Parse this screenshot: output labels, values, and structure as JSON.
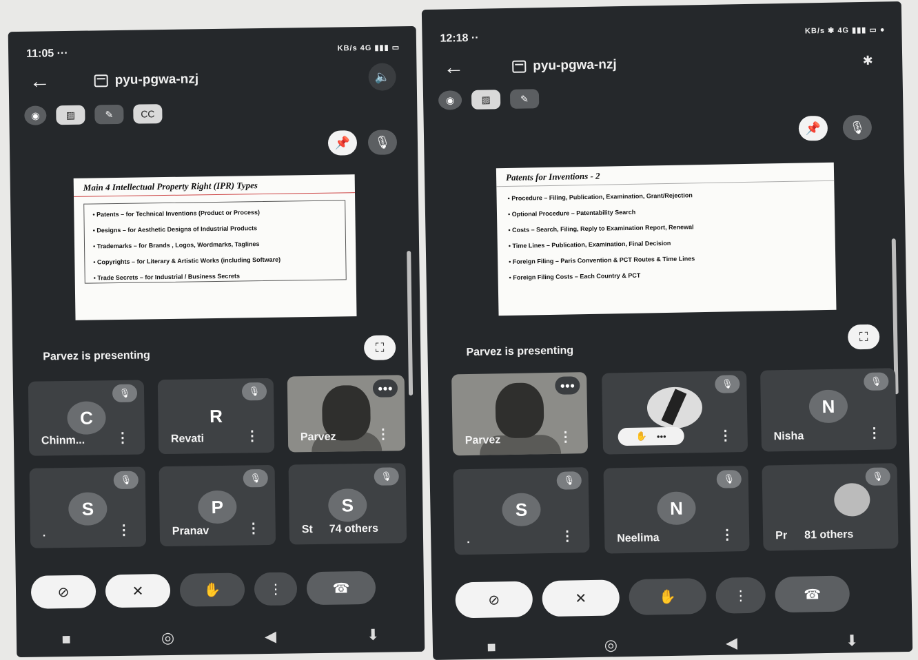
{
  "left": {
    "status": {
      "time": "11:05",
      "extra": "···",
      "icons": "KB/s 4G ▮▮▮ ▭"
    },
    "meeting_code": "pyu-pgwa-nzj",
    "slide": {
      "title": "Main 4 Intellectual Property Right (IPR) Types",
      "bullets": [
        "• Patents – for Technical Inventions (Product or Process)",
        "• Designs – for Aesthetic Designs of Industrial Products",
        "• Trademarks – for Brands , Logos, Wordmarks, Taglines",
        "• Copyrights – for Literary & Artistic Works (including Software)",
        "• Trade Secrets – for Industrial / Business Secrets"
      ]
    },
    "presenting": "Parvez is presenting",
    "tiles": [
      {
        "initial": "C",
        "name": "Chinm..."
      },
      {
        "initial": "R",
        "name": "Revati"
      },
      {
        "initial": "",
        "name": "Parvez"
      },
      {
        "initial": "S",
        "name": "."
      },
      {
        "initial": "P",
        "name": "Pranav"
      },
      {
        "initial": "S",
        "name": "St"
      }
    ],
    "others": "74 others"
  },
  "right": {
    "status": {
      "time": "12:18",
      "extra": "··",
      "icons": "KB/s ✱ 4G ▮▮▮ ▭ ●"
    },
    "meeting_code": "pyu-pgwa-nzj",
    "slide": {
      "title": "Patents for Inventions - 2",
      "bullets": [
        "• Procedure – Filing, Publication, Examination, Grant/Rejection",
        "• Optional Procedure – Patentability Search",
        "• Costs – Search, Filing, Reply to Examination Report, Renewal",
        "• Time Lines – Publication, Examination, Final Decision",
        "• Foreign Filing – Paris Convention & PCT Routes & Time Lines",
        "• Foreign Filing Costs – Each Country & PCT"
      ]
    },
    "presenting": "Parvez is presenting",
    "tiles": [
      {
        "initial": "",
        "name": "Parvez"
      },
      {
        "initial": "",
        "name": ""
      },
      {
        "initial": "N",
        "name": "Nisha"
      },
      {
        "initial": "S",
        "name": "."
      },
      {
        "initial": "N",
        "name": "Neelima"
      },
      {
        "initial": "",
        "name": "Pr"
      }
    ],
    "others": "81 others"
  },
  "icons": {
    "back": "←",
    "speaker": "🔈",
    "bluetooth": "✱",
    "pin": "📌",
    "mute": "🎙",
    "camera_off": "⊘",
    "mic_off": "✕",
    "hand": "✋",
    "more": "⋮",
    "end_call": "☎",
    "fullscreen": "⛶",
    "nav_square": "■",
    "nav_circle": "◎",
    "nav_back": "◀",
    "nav_down": "⬇"
  }
}
